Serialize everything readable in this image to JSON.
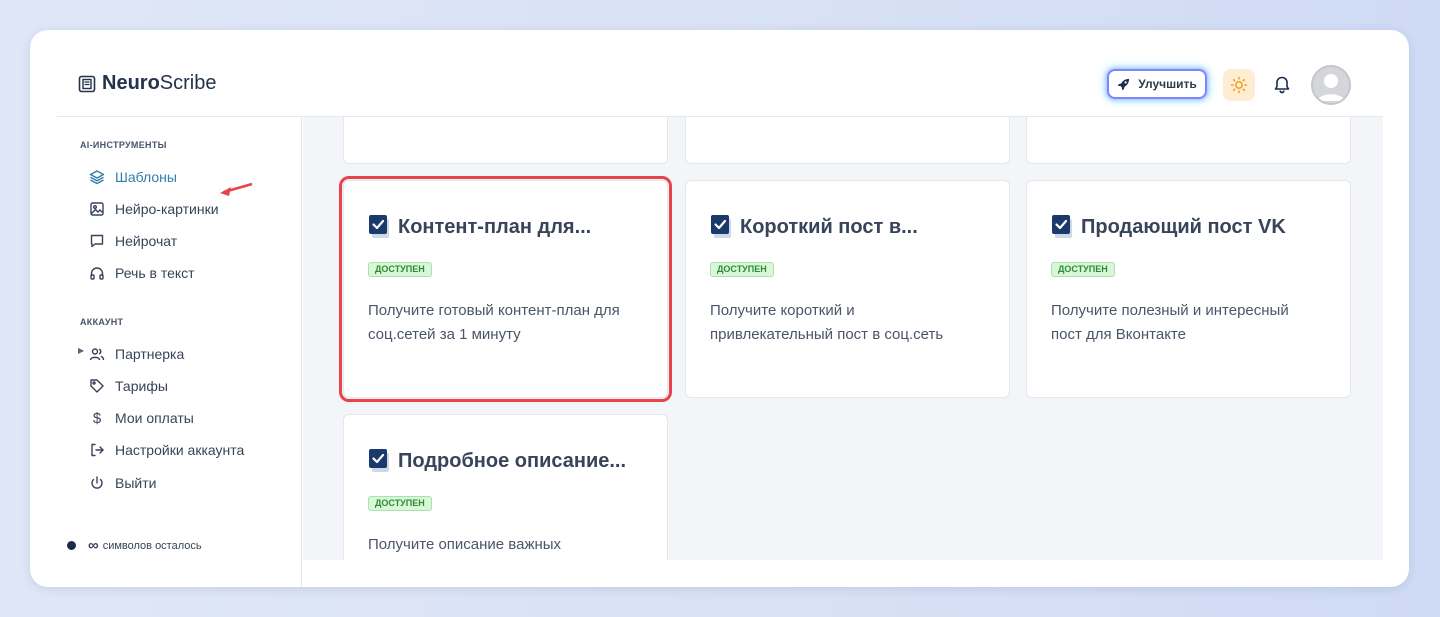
{
  "app": {
    "brand_bold": "Neuro",
    "brand_light": "Scribe"
  },
  "header": {
    "upgrade_label": "Улучшить",
    "theme_icon": "sun-icon",
    "bell_icon": "bell-icon"
  },
  "sidebar": {
    "section_tools": "AI-ИНСТРУМЕНТЫ",
    "tools": [
      {
        "label": "Шаблоны",
        "icon": "layers-icon",
        "active": true
      },
      {
        "label": "Нейро-картинки",
        "icon": "image-icon"
      },
      {
        "label": "Нейрочат",
        "icon": "chat-icon"
      },
      {
        "label": "Речь в текст",
        "icon": "headphones-icon"
      }
    ],
    "section_account": "АККАУНТ",
    "account": [
      {
        "label": "Партнерка",
        "icon": "users-icon"
      },
      {
        "label": "Тарифы",
        "icon": "tag-icon"
      },
      {
        "label": "Мои оплаты",
        "icon": "dollar-icon"
      },
      {
        "label": "Настройки аккаунта",
        "icon": "logout-arrow-icon"
      },
      {
        "label": "Выйти",
        "icon": "power-icon"
      }
    ],
    "credits_symbol": "∞",
    "credits_text": "символов осталось"
  },
  "templates": [
    {
      "title": "Контент-план для...",
      "badge": "ДОСТУПЕН",
      "description": "Получите готовый контент-план для соц.сетей за 1 минуту"
    },
    {
      "title": "Короткий пост в...",
      "badge": "ДОСТУПЕН",
      "description": "Получите короткий и привлекательный пост в соц.сеть"
    },
    {
      "title": "Продающий пост VK",
      "badge": "ДОСТУПЕН",
      "description": "Получите полезный и интересный пост для Вконтакте"
    },
    {
      "title": "Подробное описание...",
      "badge": "ДОСТУПЕН",
      "description": "Получите описание важных"
    }
  ],
  "colors": {
    "accent": "#2f7fa8",
    "highlight": "#e8434b",
    "badge_bg": "#d9f6d9",
    "badge_text": "#2d8a35",
    "dark": "#1b2b4b"
  }
}
